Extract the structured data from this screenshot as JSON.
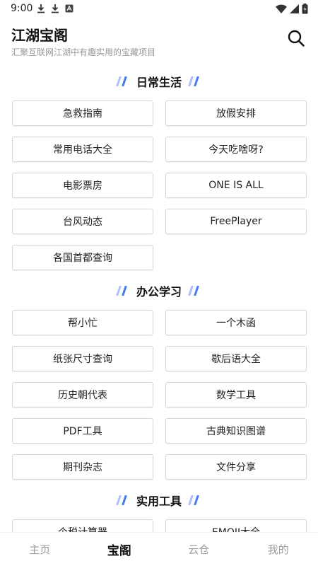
{
  "status_bar": {
    "time": "9:00"
  },
  "header": {
    "title": "江湖宝阁",
    "subtitle": "汇聚互联网江湖中有趣实用的宝藏项目"
  },
  "sections": [
    {
      "title": "日常生活",
      "items": [
        "急救指南",
        "放假安排",
        "常用电话大全",
        "今天吃啥呀?",
        "电影票房",
        "ONE  IS ALL",
        "台风动态",
        "FreePlayer",
        "各国首都查询"
      ]
    },
    {
      "title": "办公学习",
      "items": [
        "帮小忙",
        "一个木函",
        "纸张尺寸查询",
        "歇后语大全",
        "历史朝代表",
        "数学工具",
        "PDF工具",
        "古典知识图谱",
        "期刊杂志",
        "文件分享"
      ]
    },
    {
      "title": "实用工具",
      "items": [
        "个税计算器",
        "EMOJI大全"
      ]
    }
  ],
  "tabs": [
    "主页",
    "宝阁",
    "云仓",
    "我的"
  ],
  "active_tab": "宝阁",
  "colors": {
    "accent_blue": "#4a7cf0",
    "accent_light": "#a9c2f7"
  }
}
